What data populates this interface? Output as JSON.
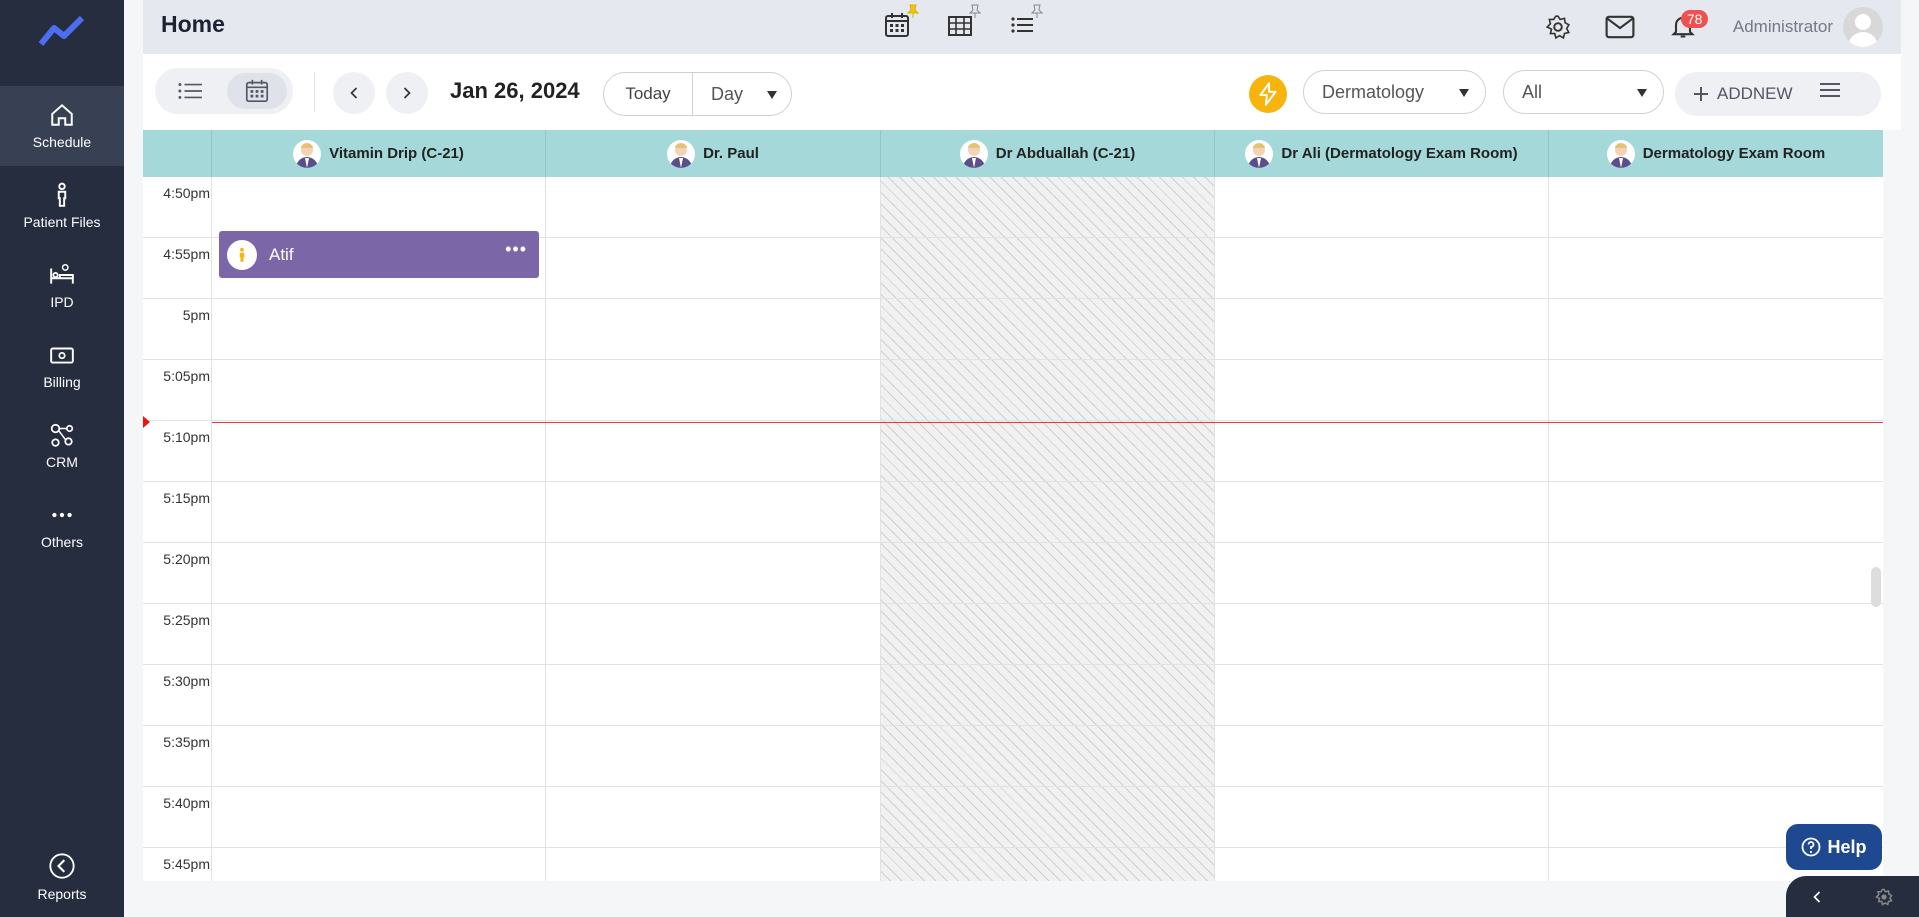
{
  "sidebar": {
    "items": [
      {
        "label": "Schedule",
        "icon": "home-icon"
      },
      {
        "label": "Patient Files",
        "icon": "person-icon"
      },
      {
        "label": "IPD",
        "icon": "bed-icon"
      },
      {
        "label": "Billing",
        "icon": "money-icon"
      },
      {
        "label": "CRM",
        "icon": "network-icon"
      },
      {
        "label": "Others",
        "icon": "more-icon"
      }
    ],
    "bottom": {
      "label": "Reports",
      "icon": "back-arrow-icon"
    }
  },
  "header": {
    "title": "Home",
    "notification_count": "78",
    "user_name": "Administrator"
  },
  "toolbar": {
    "date": "Jan 26, 2024",
    "today_label": "Today",
    "view_label": "Day",
    "department": "Dermatology",
    "filter": "All",
    "add_new": "ADDNEW"
  },
  "calendar": {
    "columns": [
      {
        "name": "Vitamin Drip (C-21)"
      },
      {
        "name": "Dr. Paul"
      },
      {
        "name": "Dr Abduallah (C-21)"
      },
      {
        "name": "Dr Ali (Dermatology Exam Room)"
      },
      {
        "name": "Dermatology Exam Room"
      }
    ],
    "times": [
      "4:50pm",
      "4:55pm",
      "5pm",
      "5:05pm",
      "5:10pm",
      "5:15pm",
      "5:20pm",
      "5:25pm",
      "5:30pm",
      "5:35pm",
      "5:40pm",
      "5:45pm"
    ],
    "appointment": {
      "name": "Atif",
      "more": "•••"
    }
  },
  "help_label": "Help",
  "colors": {
    "sidebar": "#252d3f",
    "header_row": "#a5d8d8",
    "appointment": "#7b67a8",
    "accent_yellow": "#f6b40d",
    "help": "#1e4890",
    "now_line": "#e33333"
  }
}
